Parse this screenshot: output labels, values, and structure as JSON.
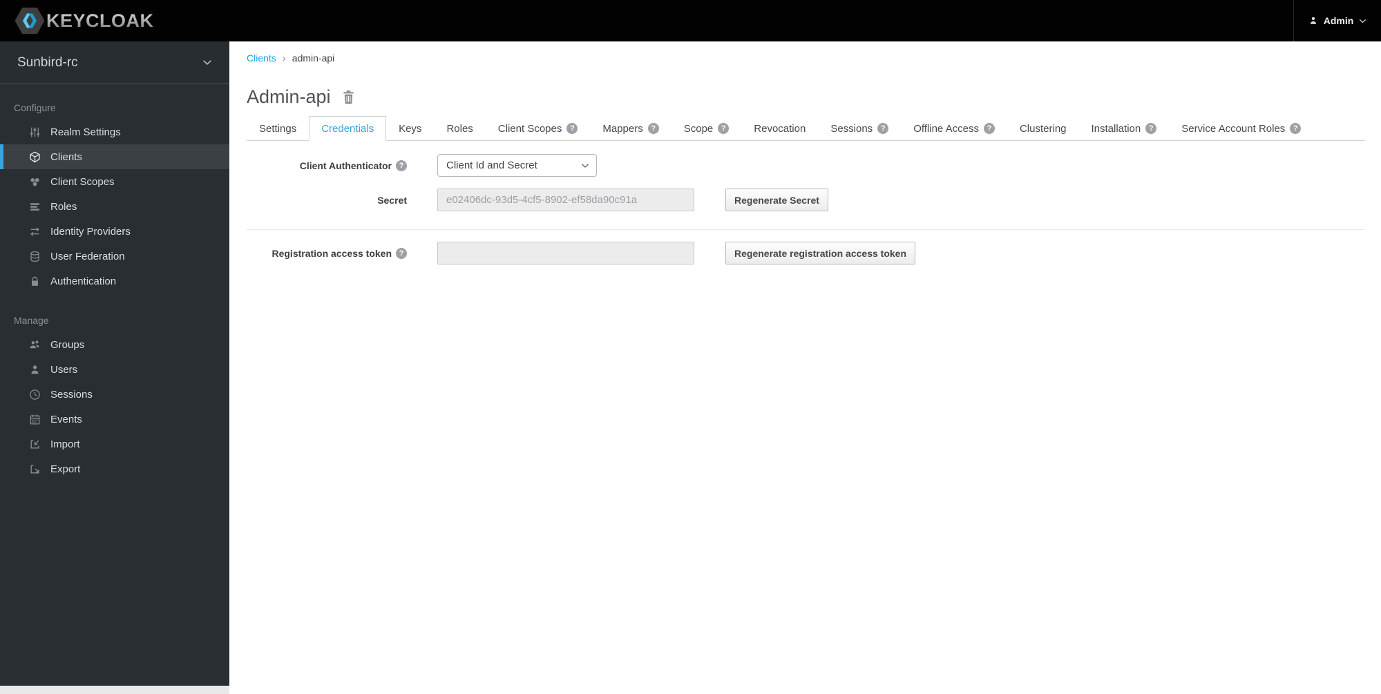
{
  "topbar": {
    "brand": "KEYCLOAK",
    "user": {
      "name": "Admin"
    }
  },
  "sidebar": {
    "realm": {
      "name": "Sunbird-rc"
    },
    "sections": [
      {
        "label": "Configure",
        "items": [
          {
            "label": "Realm Settings",
            "icon": "sliders-icon",
            "active": false
          },
          {
            "label": "Clients",
            "icon": "cube-icon",
            "active": true
          },
          {
            "label": "Client Scopes",
            "icon": "scopes-icon",
            "active": false
          },
          {
            "label": "Roles",
            "icon": "roles-icon",
            "active": false
          },
          {
            "label": "Identity Providers",
            "icon": "exchange-icon",
            "active": false
          },
          {
            "label": "User Federation",
            "icon": "database-icon",
            "active": false
          },
          {
            "label": "Authentication",
            "icon": "lock-icon",
            "active": false
          }
        ]
      },
      {
        "label": "Manage",
        "items": [
          {
            "label": "Groups",
            "icon": "group-icon",
            "active": false
          },
          {
            "label": "Users",
            "icon": "user-icon",
            "active": false
          },
          {
            "label": "Sessions",
            "icon": "clock-icon",
            "active": false
          },
          {
            "label": "Events",
            "icon": "calendar-icon",
            "active": false
          },
          {
            "label": "Import",
            "icon": "import-icon",
            "active": false
          },
          {
            "label": "Export",
            "icon": "export-icon",
            "active": false
          }
        ]
      }
    ]
  },
  "breadcrumb": {
    "items": [
      "Clients",
      "admin-api"
    ]
  },
  "page": {
    "title": "Admin-api"
  },
  "tabs": [
    {
      "label": "Settings",
      "active": false,
      "help": false
    },
    {
      "label": "Credentials",
      "active": true,
      "help": false
    },
    {
      "label": "Keys",
      "active": false,
      "help": false
    },
    {
      "label": "Roles",
      "active": false,
      "help": false
    },
    {
      "label": "Client Scopes",
      "active": false,
      "help": true
    },
    {
      "label": "Mappers",
      "active": false,
      "help": true
    },
    {
      "label": "Scope",
      "active": false,
      "help": true
    },
    {
      "label": "Revocation",
      "active": false,
      "help": false
    },
    {
      "label": "Sessions",
      "active": false,
      "help": true
    },
    {
      "label": "Offline Access",
      "active": false,
      "help": true
    },
    {
      "label": "Clustering",
      "active": false,
      "help": false
    },
    {
      "label": "Installation",
      "active": false,
      "help": true
    },
    {
      "label": "Service Account Roles",
      "active": false,
      "help": true
    }
  ],
  "form": {
    "client_authenticator": {
      "label": "Client Authenticator",
      "value": "Client Id and Secret"
    },
    "secret": {
      "label": "Secret",
      "value": "e02406dc-93d5-4cf5-8902-ef58da90c91a",
      "button": "Regenerate Secret"
    },
    "registration_token": {
      "label": "Registration access token",
      "value": "",
      "button": "Regenerate registration access token"
    }
  },
  "icons": {
    "help": "?"
  },
  "colors": {
    "topbar_bg": "#020202",
    "sidebar_bg": "#292e33",
    "accent": "#39a5dc",
    "link": "#1aa0dd",
    "active_item_bg": "#3b4045"
  }
}
